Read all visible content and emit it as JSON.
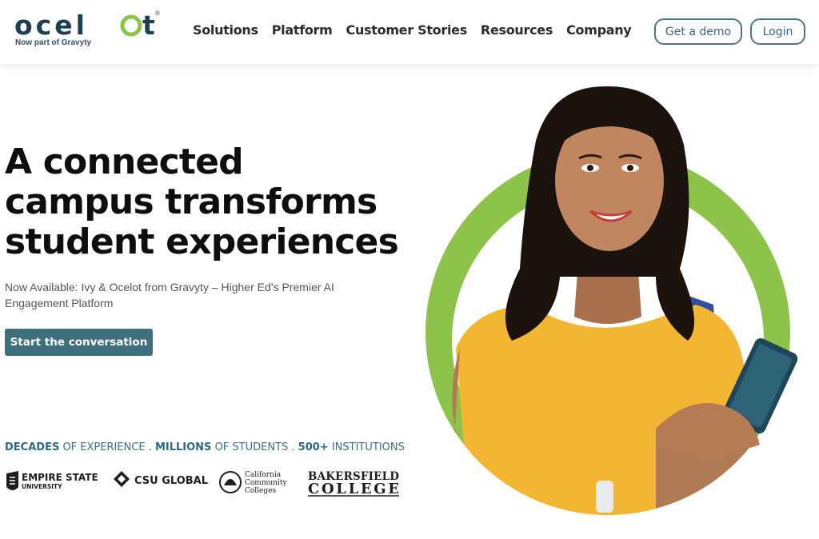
{
  "brand": {
    "name": "ocelot",
    "tagline": "Now part of Gravyty",
    "registered": "®"
  },
  "nav": {
    "items": [
      "Solutions",
      "Platform",
      "Customer Stories",
      "Resources",
      "Company"
    ]
  },
  "header_actions": {
    "demo_label": "Get a demo",
    "login_label": "Login"
  },
  "hero": {
    "title_line1": "A connected",
    "title_line2": "campus transforms",
    "title_line3": "student experiences",
    "subtitle": "Now Available: Ivy & Ocelot from Gravyty – Higher Ed’s Premier AI Engagement Platform",
    "cta_label": "Start the conversation"
  },
  "stats": {
    "decades": "DECADES",
    "experience": " OF EXPERIENCE . ",
    "millions": "MILLIONS",
    "students": " OF STUDENTS . ",
    "institutions_count": "500+",
    "institutions": " INSTITUTIONS"
  },
  "partners": {
    "esu_line1": "EMPIRE STATE",
    "esu_line2": "UNIVERSITY",
    "csu": "CSU GLOBAL",
    "ccc_line1": "California",
    "ccc_line2": "Community",
    "ccc_line3": "Colleges",
    "bak_line1": "BAKERSFIELD",
    "bak_line2": "COLLEGE"
  },
  "colors": {
    "brand_dark": "#1d3f52",
    "brand_green": "#8dc34a",
    "cta_teal": "#3f6f7d",
    "shirt_yellow": "#f2b632",
    "backpack_blue": "#2f4fa3"
  }
}
